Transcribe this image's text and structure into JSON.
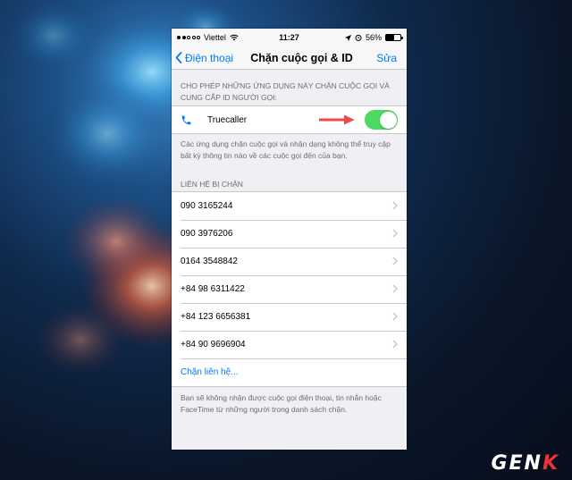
{
  "status_bar": {
    "carrier": "Viettel",
    "time": "11:27",
    "battery_percent": "56%",
    "battery_level": 0.56
  },
  "nav": {
    "back_label": "Điện thoại",
    "title": "Chặn cuộc gọi & ID",
    "edit_label": "Sửa"
  },
  "call_blocking": {
    "header": "CHO PHÉP NHỮNG ỨNG DỤNG NÀY CHẶN CUỘC GỌI VÀ CUNG CẤP ID NGƯỜI GỌI:",
    "app_name": "Truecaller",
    "enabled": true,
    "footer": "Các ứng dụng chặn cuộc gọi và nhận dạng không thể truy cập bất kỳ thông tin nào về các cuộc gọi đến của bạn."
  },
  "blocked": {
    "header": "LIÊN HỆ BỊ CHẶN",
    "numbers": [
      "090 3165244",
      "090 3976206",
      "0164 3548842",
      "+84 98 6311422",
      "+84 123 6656381",
      "+84 90 9696904"
    ],
    "add_label": "Chặn liên hệ...",
    "footer": "Bạn sẽ không nhận được cuộc gọi điện thoại, tin nhắn hoặc FaceTime từ những người trong danh sách chặn."
  },
  "colors": {
    "accent": "#007aff",
    "toggle_on": "#4cd964",
    "arrow": "#f0484a"
  },
  "watermark": "GENK"
}
